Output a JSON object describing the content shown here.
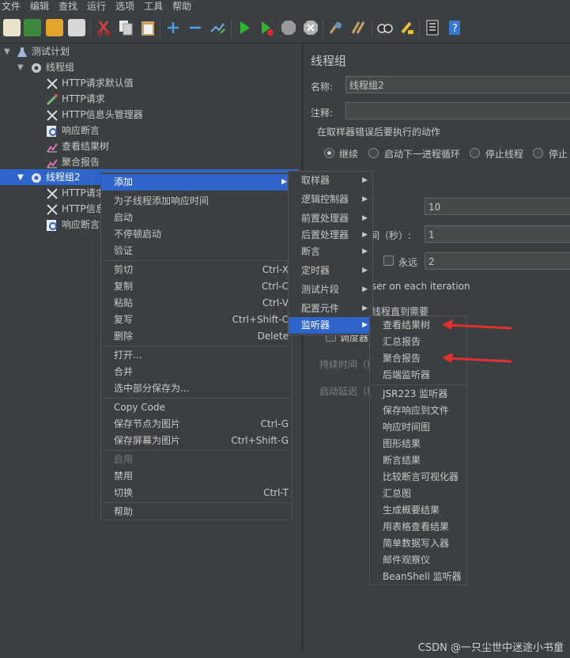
{
  "menubar": [
    "文件",
    "编辑",
    "查找",
    "运行",
    "选项",
    "工具",
    "帮助"
  ],
  "toolbar_icons": [
    "new-icon",
    "templates-icon",
    "open-icon",
    "save-icon",
    "cut-icon",
    "copy-icon",
    "paste-icon",
    "expand-icon",
    "collapse-icon",
    "toggle-icon",
    "start-icon",
    "start-no-pause-icon",
    "stop-icon",
    "shutdown-icon",
    "clear-icon",
    "clear-all-icon",
    "search-icon",
    "reset-search-icon",
    "function-helper-icon",
    "help-icon"
  ],
  "tree": {
    "root": "测试计划",
    "group1": "线程组",
    "g1_items": [
      "HTTP请求默认值",
      "HTTP请求",
      "HTTP信息头管理器",
      "响应断言",
      "查看结果树",
      "聚合报告"
    ],
    "group2": "线程组2",
    "g2_items": [
      "HTTP请求",
      "HTTP信息",
      "响应断言"
    ]
  },
  "panel": {
    "title": "线程组",
    "name_label": "名称:",
    "name_value": "线程组2",
    "comment_label": "注释:",
    "error_section": "在取样器错误后要执行的动作",
    "radio_continue": "继续",
    "radio_next_loop": "启动下一进程循环",
    "radio_stop_thread": "停止线程",
    "radio_stop_test": "停止",
    "threads_value": "10",
    "rampup_label": "间（秒）:",
    "rampup_value": "1",
    "forever_label": "永远",
    "loops_value": "2",
    "same_user": "ser on each iteration",
    "delay_create": "线程直到需要",
    "scheduler": "调度器",
    "duration_label": "持续时间（秒）",
    "startup_delay_label": "启动延迟（秒）"
  },
  "context_menu": {
    "add": "添加",
    "items": [
      {
        "label": "为子线程添加响应时间",
        "shortcut": ""
      },
      {
        "label": "启动",
        "shortcut": ""
      },
      {
        "label": "不停顿启动",
        "shortcut": ""
      },
      {
        "label": "验证",
        "shortcut": ""
      }
    ],
    "edit_items": [
      {
        "label": "剪切",
        "shortcut": "Ctrl-X"
      },
      {
        "label": "复制",
        "shortcut": "Ctrl-C"
      },
      {
        "label": "粘贴",
        "shortcut": "Ctrl-V"
      },
      {
        "label": "复写",
        "shortcut": "Ctrl+Shift-C"
      },
      {
        "label": "删除",
        "shortcut": "Delete"
      }
    ],
    "file_items": [
      "打开...",
      "合并",
      "选中部分保存为..."
    ],
    "copy_items": [
      {
        "label": "Copy Code",
        "shortcut": ""
      },
      {
        "label": "保存节点为图片",
        "shortcut": "Ctrl-G"
      },
      {
        "label": "保存屏幕为图片",
        "shortcut": "Ctrl+Shift-G"
      }
    ],
    "enable": "启用",
    "disable": "禁用",
    "toggle": "切换",
    "toggle_shortcut": "Ctrl-T",
    "help": "帮助"
  },
  "add_submenu": [
    "取样器",
    "逻辑控制器",
    "前置处理器",
    "后置处理器",
    "断言",
    "定时器",
    "测试片段",
    "配置元件",
    "监听器"
  ],
  "listener_submenu": [
    "查看结果树",
    "汇总报告",
    "聚合报告",
    "后端监听器",
    "JSR223 监听器",
    "保存响应到文件",
    "响应时间图",
    "图形结果",
    "断言结果",
    "比较断言可视化器",
    "汇总图",
    "生成概要结果",
    "用表格查看结果",
    "简单数据写入器",
    "邮件观察仪",
    "BeanShell 监听器"
  ],
  "watermark": "CSDN @一只尘世中迷途小书童",
  "colors": {
    "selection": "#2f65ca",
    "arrow": "#e03030",
    "background": "#3c3f41"
  }
}
